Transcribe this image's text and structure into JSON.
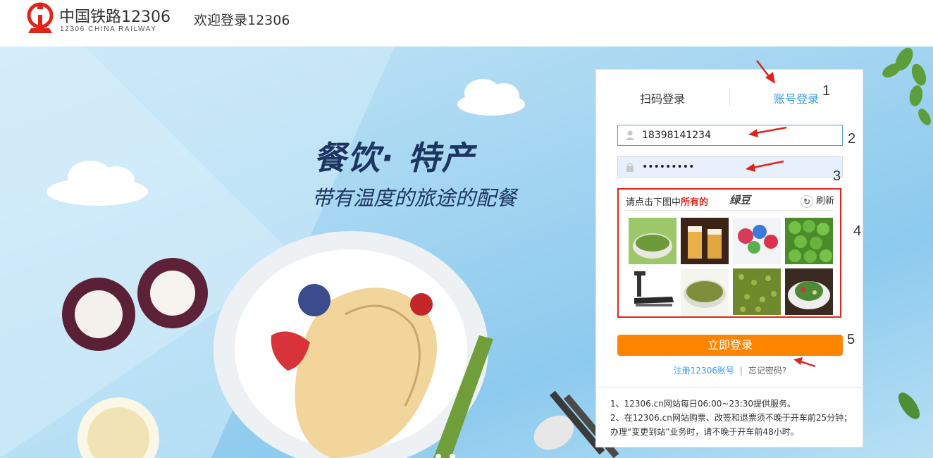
{
  "header": {
    "logo_cn": "中国铁路12306",
    "logo_en": "12306 CHINA RAILWAY",
    "welcome": "欢迎登录12306"
  },
  "banner": {
    "title": "餐饮· 特产",
    "subtitle": "带有温度的旅途的配餐"
  },
  "login": {
    "tabs": {
      "qr": "扫码登录",
      "account": "账号登录"
    },
    "username": "18398141234",
    "password": "•••••••••",
    "captcha": {
      "prompt_prefix": "请点击下图中",
      "prompt_highlight": "所有的",
      "target_word": "绿豆",
      "refresh": "刷新",
      "images": [
        "mung-beans-bowl",
        "beer-glasses",
        "candy-lollipops",
        "green-peas",
        "treadmill",
        "mung-beans-plate",
        "mung-beans-pile",
        "salad-dish"
      ]
    },
    "submit": "立即登录",
    "register": "注册12306账号",
    "separator": "|",
    "forgot": "忘记密码?",
    "notices": [
      "1、12306.cn网站每日06:00~23:30提供服务。",
      "2、在12306.cn网站购票、改签和退票须不晚于开车前25分钟；办理“变更到站”业务时，请不晚于开车前48小时。"
    ]
  },
  "annotations": {
    "markers": [
      "1",
      "2",
      "3",
      "4",
      "5"
    ],
    "color": "#e0241c"
  },
  "colors": {
    "brand_red": "#e0241c",
    "link_blue": "#3b99fc",
    "button_orange": "#ff8400",
    "title_navy": "#1d3561"
  }
}
